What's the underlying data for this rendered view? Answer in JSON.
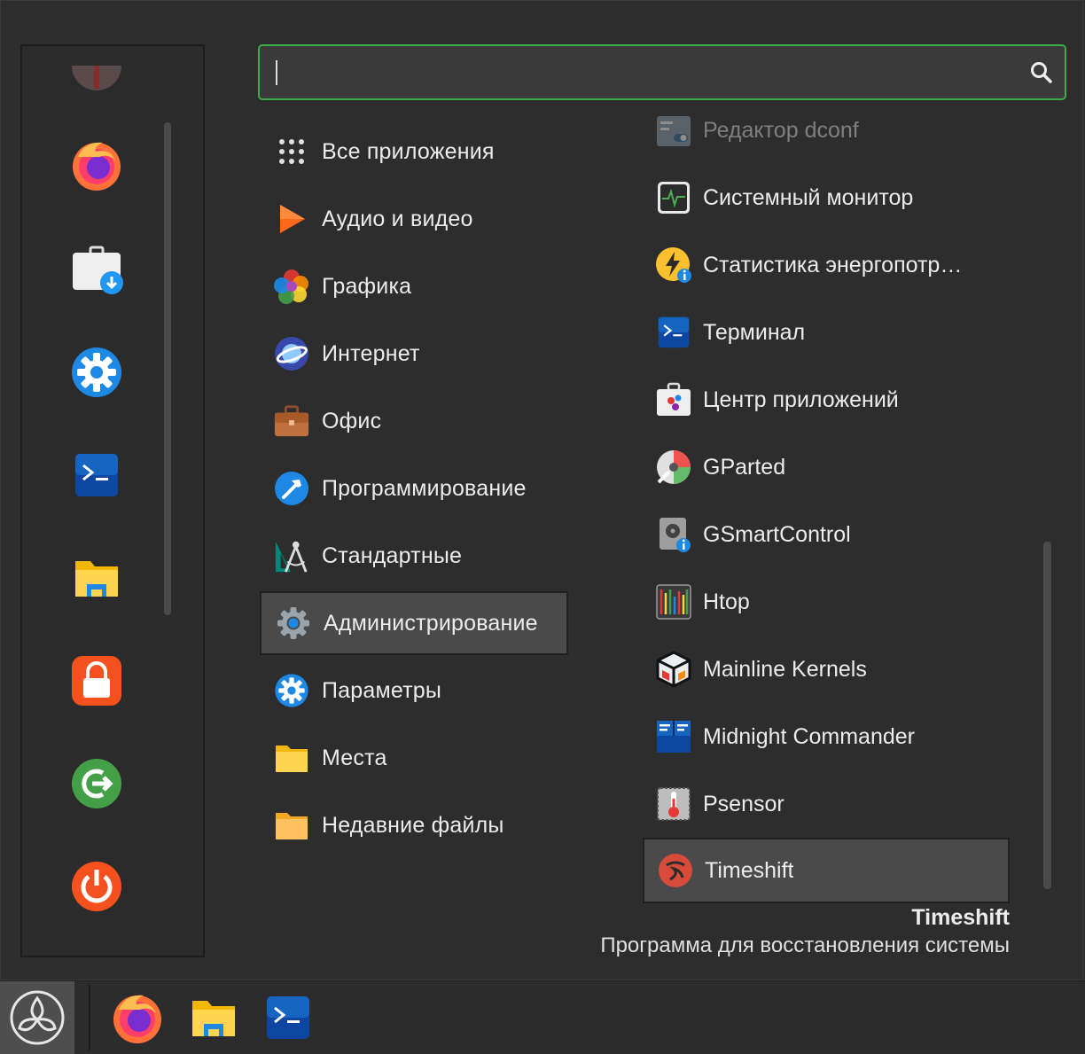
{
  "search": {
    "value": "",
    "placeholder": ""
  },
  "favorites": [
    {
      "name": "fav-partial-app",
      "icon": "app-icon-partial"
    },
    {
      "name": "fav-firefox",
      "icon": "firefox-icon"
    },
    {
      "name": "fav-software-manager",
      "icon": "software-manager-icon"
    },
    {
      "name": "fav-settings",
      "icon": "settings-gear-icon"
    },
    {
      "name": "fav-terminal",
      "icon": "terminal-icon"
    },
    {
      "name": "fav-files",
      "icon": "folder-icon"
    },
    {
      "name": "fav-lock-screen",
      "icon": "lock-icon"
    },
    {
      "name": "fav-logout",
      "icon": "logout-icon"
    },
    {
      "name": "fav-shutdown",
      "icon": "power-icon"
    }
  ],
  "categories": [
    {
      "label": "Все приложения",
      "icon": "grid-icon"
    },
    {
      "label": "Аудио и видео",
      "icon": "play-icon"
    },
    {
      "label": "Графика",
      "icon": "graphics-icon"
    },
    {
      "label": "Интернет",
      "icon": "internet-icon"
    },
    {
      "label": "Офис",
      "icon": "briefcase-icon"
    },
    {
      "label": "Программирование",
      "icon": "hammer-icon"
    },
    {
      "label": "Стандартные",
      "icon": "accessories-icon"
    },
    {
      "label": "Администрирование",
      "icon": "admin-gear-icon",
      "selected": true
    },
    {
      "label": "Параметры",
      "icon": "settings-gear-icon"
    },
    {
      "label": "Места",
      "icon": "folder-icon"
    },
    {
      "label": "Недавние файлы",
      "icon": "recent-folder-icon"
    }
  ],
  "apps": [
    {
      "label": "Редактор dconf",
      "icon": "dconf-editor-icon",
      "faded": true
    },
    {
      "label": "Системный монитор",
      "icon": "system-monitor-icon"
    },
    {
      "label": "Статистика энергопотр…",
      "icon": "power-statistics-icon"
    },
    {
      "label": "Терминал",
      "icon": "terminal-icon"
    },
    {
      "label": "Центр приложений",
      "icon": "app-center-icon"
    },
    {
      "label": "GParted",
      "icon": "gparted-icon"
    },
    {
      "label": "GSmartControl",
      "icon": "gsmartcontrol-icon"
    },
    {
      "label": "Htop",
      "icon": "htop-icon"
    },
    {
      "label": "Mainline Kernels",
      "icon": "mainline-kernels-icon"
    },
    {
      "label": "Midnight Commander",
      "icon": "midnight-commander-icon"
    },
    {
      "label": "Psensor",
      "icon": "psensor-icon"
    },
    {
      "label": "Timeshift",
      "icon": "timeshift-icon",
      "selected": true
    }
  ],
  "description": {
    "title": "Timeshift",
    "text": "Программа для восстановления системы"
  },
  "panel": {
    "launchers": [
      {
        "name": "panel-firefox",
        "icon": "firefox-icon"
      },
      {
        "name": "panel-files",
        "icon": "folder-icon"
      },
      {
        "name": "panel-terminal",
        "icon": "terminal-icon"
      }
    ]
  },
  "colors": {
    "accent_green": "#3daa4b",
    "menu_bg": "#2d2d2d",
    "selected_bg": "#4a4a4a"
  }
}
